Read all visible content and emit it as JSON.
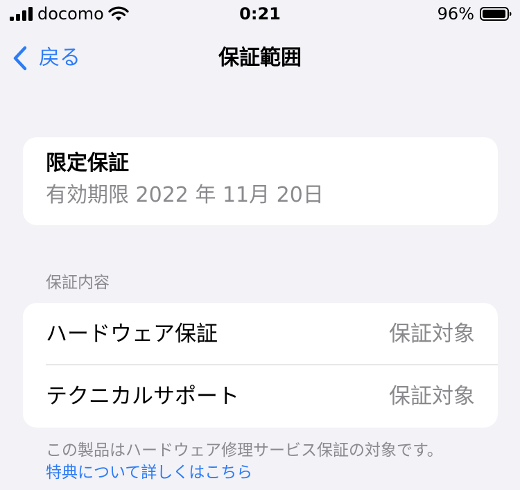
{
  "status_bar": {
    "carrier": "docomo",
    "time": "0:21",
    "battery_percent": "96%",
    "signal_icon": "signal-icon",
    "wifi_icon": "wifi-icon",
    "battery_icon": "battery-icon"
  },
  "nav": {
    "back_label": "戻る",
    "back_icon": "chevron-left-icon",
    "title": "保証範囲"
  },
  "warranty": {
    "title": "限定保証",
    "expiry": "有効期限 2022 年 11月 20日"
  },
  "coverage": {
    "section_header": "保証内容",
    "rows": [
      {
        "label": "ハードウェア保証",
        "value": "保証対象"
      },
      {
        "label": "テクニカルサポート",
        "value": "保証対象"
      }
    ]
  },
  "footer": {
    "note": "この製品はハードウェア修理サービス保証の対象です。",
    "link": "特典について詳しくはこちら"
  },
  "colors": {
    "background": "#f2f2f7",
    "card": "#ffffff",
    "accent": "#2d7cf6",
    "secondary_text": "#8a8a8e",
    "separator": "#c6c6c8"
  }
}
